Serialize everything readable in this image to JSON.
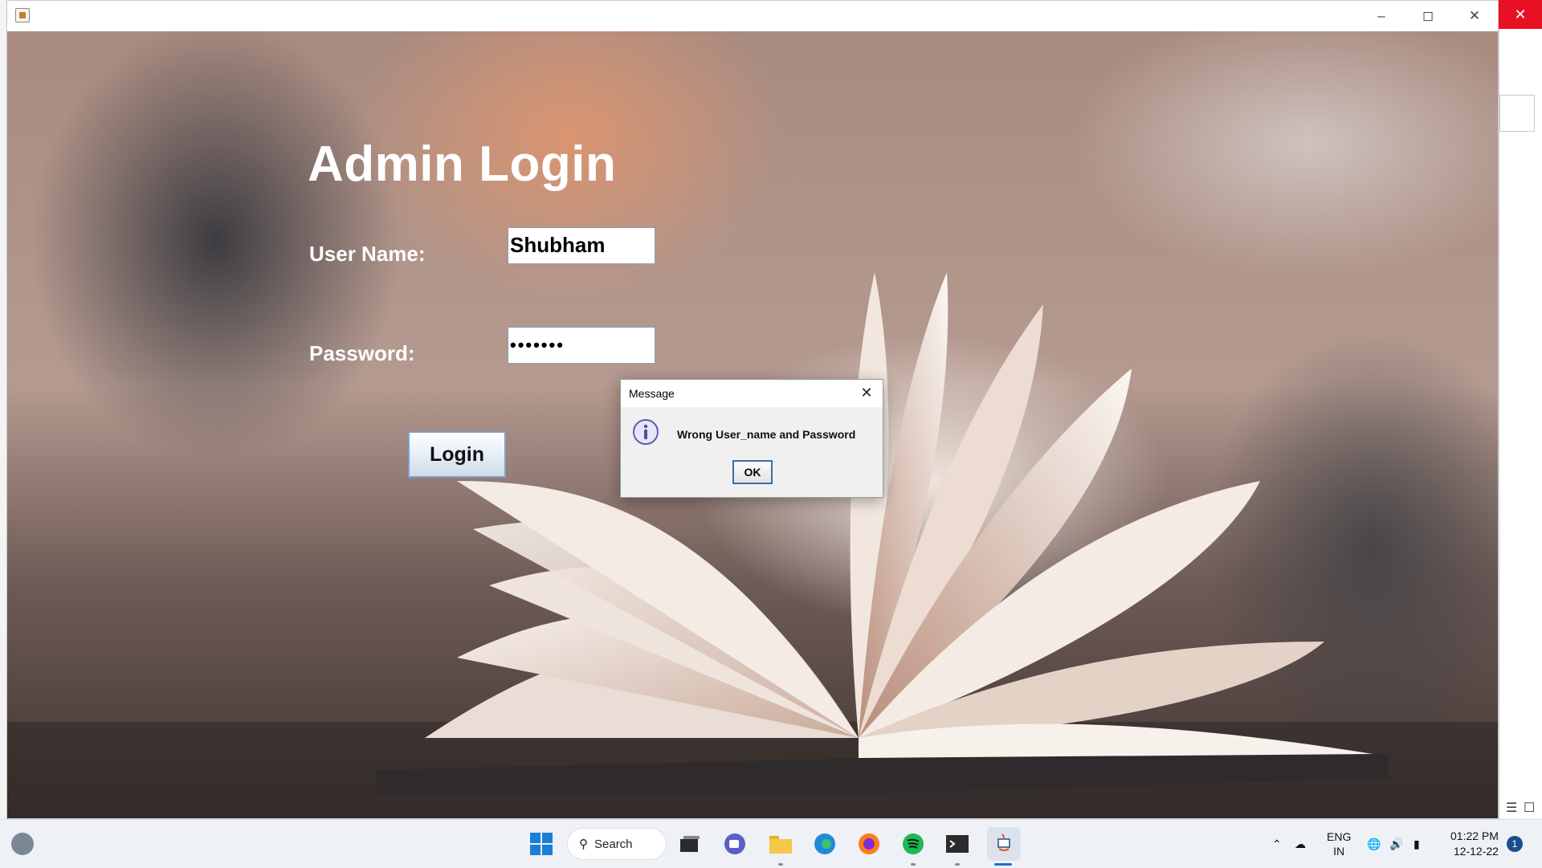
{
  "window": {
    "minimize_icon": "minimize-icon",
    "maximize_icon": "maximize-icon",
    "close_icon": "close-icon"
  },
  "form": {
    "title": "Admin Login",
    "username_label": "User Name:",
    "username_value": "Shubham",
    "password_label": "Password:",
    "password_value": "•••••••",
    "login_label": "Login"
  },
  "dialog": {
    "title": "Message",
    "message": "Wrong User_name and Password",
    "ok_label": "OK",
    "icon": "info-icon"
  },
  "taskbar": {
    "search_label": "Search",
    "language_top": "ENG",
    "language_bottom": "IN",
    "time": "01:22 PM",
    "date": "12-12-22",
    "notification_count": "1"
  }
}
